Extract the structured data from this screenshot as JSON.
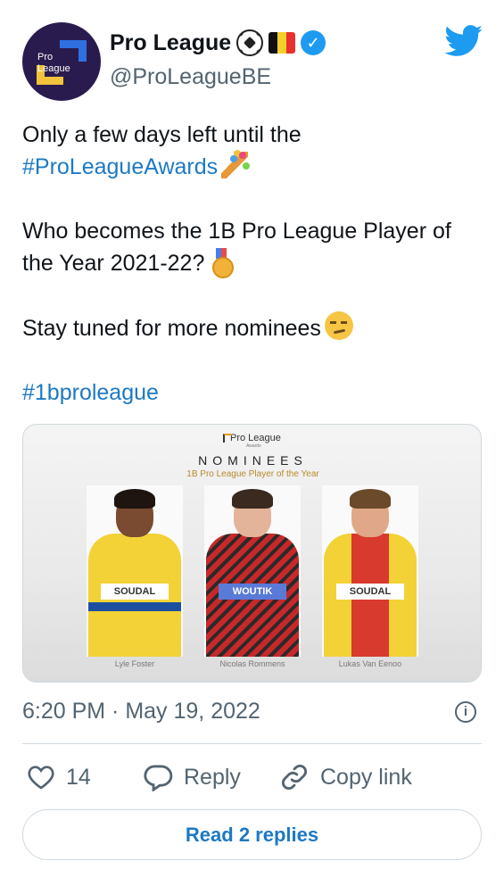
{
  "account": {
    "display_name": "Pro League",
    "handle": "@ProLeagueBE",
    "avatar_text_line1": "Pro",
    "avatar_text_line2": "League",
    "name_emojis": [
      "soccer-ball",
      "belgium-flag"
    ],
    "verified": true
  },
  "tweet": {
    "line1": "Only a few days left until the",
    "hashtag1": "#ProLeagueAwards",
    "line2": "Who becomes the 1B Pro League Player of",
    "line3": "the Year 2021-22?",
    "line4": "Stay tuned for more nominees",
    "hashtag2": "#1bproleague",
    "emojis": [
      "party-popper",
      "sports-medal",
      "smirking-face"
    ]
  },
  "media": {
    "logo_text": "Pro League",
    "logo_subtext": "Awards",
    "heading": "NOMINEES",
    "subheading": "1B Pro League Player of the Year",
    "nominees": [
      {
        "name": "Lyle Foster",
        "sponsor": "SOUDAL"
      },
      {
        "name": "Nicolas Rommens",
        "sponsor": "WOUTIK"
      },
      {
        "name": "Lukas Van Eenoo",
        "sponsor": "SOUDAL"
      }
    ]
  },
  "timestamp": "6:20 PM · May 19, 2022",
  "actions": {
    "like_count": "14",
    "reply_label": "Reply",
    "copy_label": "Copy link"
  },
  "read_replies_label": "Read 2 replies",
  "colors": {
    "accent": "#1d79c4",
    "twitter_blue": "#1d9bf0",
    "muted": "#536471",
    "border": "#cfd9de"
  }
}
